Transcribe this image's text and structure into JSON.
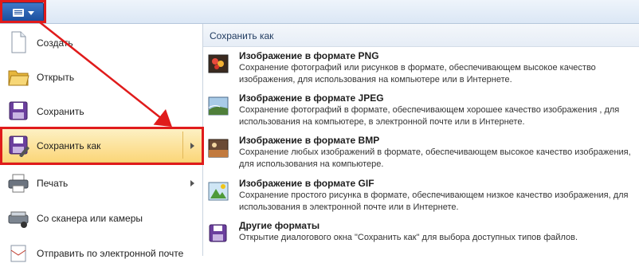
{
  "menu": {
    "items": [
      {
        "label": "Создать",
        "icon": "new-document-icon"
      },
      {
        "label": "Открыть",
        "icon": "open-folder-icon"
      },
      {
        "label": "Сохранить",
        "icon": "save-icon"
      },
      {
        "label": "Сохранить как",
        "icon": "save-as-icon"
      },
      {
        "label": "Печать",
        "icon": "printer-icon"
      },
      {
        "label": "Со сканера или камеры",
        "icon": "scanner-icon"
      },
      {
        "label": "Отправить по электронной почте",
        "icon": "email-icon"
      }
    ]
  },
  "submenu": {
    "header": "Сохранить как",
    "options": [
      {
        "title": "Изображение в формате PNG",
        "desc": "Сохранение фотографий или рисунков в формате, обеспечивающем высокое качество изображения, для использования на компьютере или в Интернете.",
        "icon": "png-image-icon"
      },
      {
        "title": "Изображение в формате JPEG",
        "desc": "Сохранение фотографий в формате, обеспечивающем хорошее качество изображения , для использования на компьютере, в электронной почте или в Интернете.",
        "icon": "jpeg-image-icon"
      },
      {
        "title": "Изображение в формате BMP",
        "desc": "Сохранение любых изображений в формате, обеспечивающем высокое качество изображения, для использования на компьютере.",
        "icon": "bmp-image-icon"
      },
      {
        "title": "Изображение в формате GIF",
        "desc": "Сохранение простого рисунка в формате, обеспечивающем низкое качество изображения, для использования в электронной почте или в Интернете.",
        "icon": "gif-image-icon"
      },
      {
        "title": "Другие форматы",
        "desc": "Открытие диалогового окна \"Сохранить как\" для выбора доступных типов файлов.",
        "icon": "other-formats-icon"
      }
    ]
  },
  "colors": {
    "highlight": "#fbd679",
    "annotation": "#e01b1b",
    "app_button": "#1c4f9e"
  }
}
